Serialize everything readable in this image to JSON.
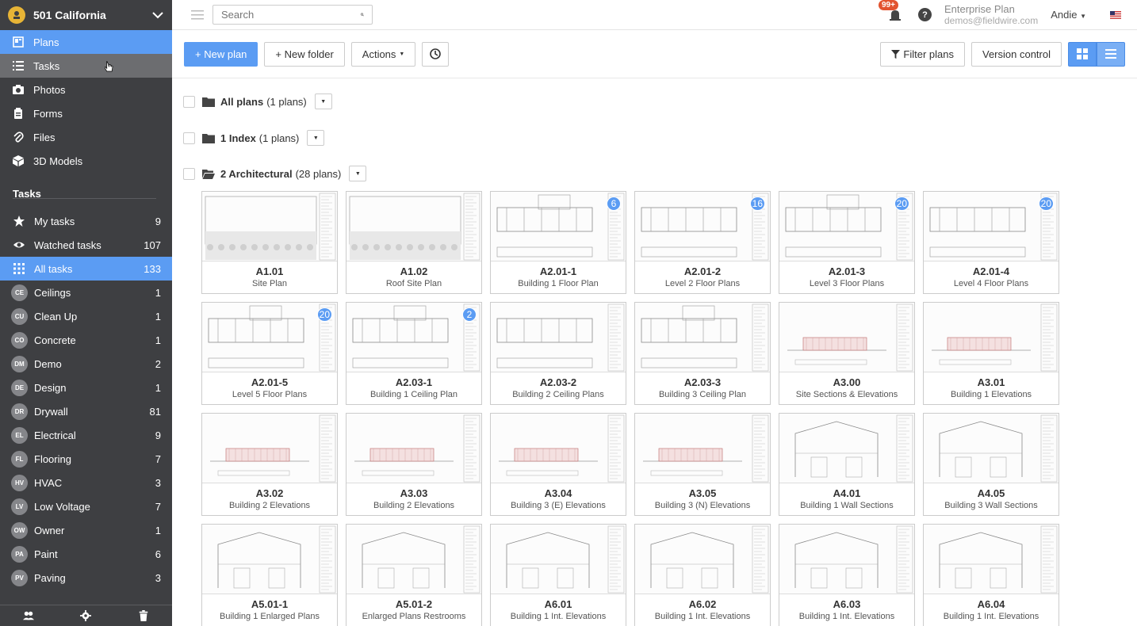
{
  "project": {
    "name": "501 California"
  },
  "nav": [
    {
      "label": "Plans",
      "icon": "plans-icon",
      "state": "active"
    },
    {
      "label": "Tasks",
      "icon": "tasks-icon",
      "state": "hover"
    },
    {
      "label": "Photos",
      "icon": "camera-icon",
      "state": ""
    },
    {
      "label": "Forms",
      "icon": "clipboard-icon",
      "state": ""
    },
    {
      "label": "Files",
      "icon": "paperclip-icon",
      "state": ""
    },
    {
      "label": "3D Models",
      "icon": "cube-icon",
      "state": ""
    }
  ],
  "tasks_section": {
    "title": "Tasks",
    "rows": [
      {
        "label": "My tasks",
        "count": "9",
        "icon": "star-icon"
      },
      {
        "label": "Watched tasks",
        "count": "107",
        "icon": "eye-icon"
      },
      {
        "label": "All tasks",
        "count": "133",
        "icon": "grid-icon",
        "active": true
      },
      {
        "label": "Ceilings",
        "count": "1",
        "badge": "CE"
      },
      {
        "label": "Clean Up",
        "count": "1",
        "badge": "CU"
      },
      {
        "label": "Concrete",
        "count": "1",
        "badge": "CO"
      },
      {
        "label": "Demo",
        "count": "2",
        "badge": "DM"
      },
      {
        "label": "Design",
        "count": "1",
        "badge": "DE"
      },
      {
        "label": "Drywall",
        "count": "81",
        "badge": "DR"
      },
      {
        "label": "Electrical",
        "count": "9",
        "badge": "EL"
      },
      {
        "label": "Flooring",
        "count": "7",
        "badge": "FL"
      },
      {
        "label": "HVAC",
        "count": "3",
        "badge": "HV"
      },
      {
        "label": "Low Voltage",
        "count": "7",
        "badge": "LV"
      },
      {
        "label": "Owner",
        "count": "1",
        "badge": "OW"
      },
      {
        "label": "Paint",
        "count": "6",
        "badge": "PA"
      },
      {
        "label": "Paving",
        "count": "3",
        "badge": "PV"
      }
    ]
  },
  "topbar": {
    "search_placeholder": "Search",
    "notif_badge": "99+",
    "help": "?",
    "plan_name": "Enterprise Plan",
    "email": "demos@fieldwire.com",
    "user": "Andie"
  },
  "toolbar": {
    "new_plan": "New plan",
    "new_folder": "New folder",
    "actions": "Actions",
    "filter_plans": "Filter plans",
    "version_control": "Version control"
  },
  "folders": [
    {
      "name": "All plans",
      "count": "(1 plans)",
      "open": false
    },
    {
      "name": "1 Index",
      "count": "(1 plans)",
      "open": false
    },
    {
      "name": "2 Architectural",
      "count": "(28 plans)",
      "open": true
    }
  ],
  "plans": [
    {
      "num": "A1.01",
      "title": "Site Plan",
      "badge": ""
    },
    {
      "num": "A1.02",
      "title": "Roof Site Plan",
      "badge": ""
    },
    {
      "num": "A2.01-1",
      "title": "Building 1 Floor Plan",
      "badge": "6"
    },
    {
      "num": "A2.01-2",
      "title": "Level 2 Floor Plans",
      "badge": "16"
    },
    {
      "num": "A2.01-3",
      "title": "Level 3 Floor Plans",
      "badge": "20"
    },
    {
      "num": "A2.01-4",
      "title": "Level 4 Floor Plans",
      "badge": "20"
    },
    {
      "num": "A2.01-5",
      "title": "Level 5 Floor Plans",
      "badge": "20"
    },
    {
      "num": "A2.03-1",
      "title": "Building 1 Ceiling Plan",
      "badge": "2"
    },
    {
      "num": "A2.03-2",
      "title": "Building 2 Ceiling Plans",
      "badge": ""
    },
    {
      "num": "A2.03-3",
      "title": "Building 3 Ceiling Plan",
      "badge": ""
    },
    {
      "num": "A3.00",
      "title": "Site Sections & Elevations",
      "badge": ""
    },
    {
      "num": "A3.01",
      "title": "Building 1 Elevations",
      "badge": ""
    },
    {
      "num": "A3.02",
      "title": "Building 2 Elevations",
      "badge": ""
    },
    {
      "num": "A3.03",
      "title": "Building 2 Elevations",
      "badge": ""
    },
    {
      "num": "A3.04",
      "title": "Building 3 (E) Elevations",
      "badge": ""
    },
    {
      "num": "A3.05",
      "title": "Building 3 (N) Elevations",
      "badge": ""
    },
    {
      "num": "A4.01",
      "title": "Building 1 Wall Sections",
      "badge": ""
    },
    {
      "num": "A4.05",
      "title": "Building 3 Wall Sections",
      "badge": ""
    },
    {
      "num": "A5.01-1",
      "title": "Building 1 Enlarged Plans",
      "badge": ""
    },
    {
      "num": "A5.01-2",
      "title": "Enlarged Plans Restrooms",
      "badge": ""
    },
    {
      "num": "A6.01",
      "title": "Building 1 Int. Elevations",
      "badge": ""
    },
    {
      "num": "A6.02",
      "title": "Building 1 Int. Elevations",
      "badge": ""
    },
    {
      "num": "A6.03",
      "title": "Building 1 Int. Elevations",
      "badge": ""
    },
    {
      "num": "A6.04",
      "title": "Building 1 Int. Elevations",
      "badge": ""
    }
  ],
  "colors": {
    "accent": "#5b9cf3",
    "sidebar": "#3e3f42",
    "badge_red": "#e2532f"
  }
}
